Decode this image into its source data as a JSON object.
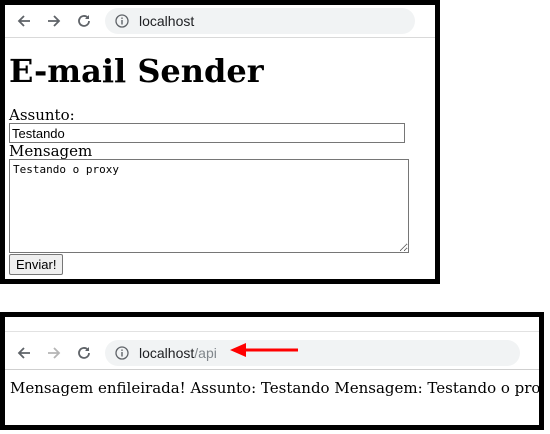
{
  "window1": {
    "address_host": "localhost",
    "heading": "E-mail Sender",
    "form": {
      "subject_label": "Assunto:",
      "subject_value": "Testando",
      "message_label": "Mensagem",
      "message_value": "Testando o proxy",
      "send_label": "Enviar!"
    }
  },
  "window2": {
    "address_host": "localhost",
    "address_path": "/api",
    "result_text": "Mensagem enfileirada! Assunto: Testando Mensagem: Testando o proxy"
  },
  "colors": {
    "annotation_arrow": "#ff0000"
  },
  "icons": [
    "back-arrow-icon",
    "forward-arrow-icon",
    "reload-icon",
    "info-icon",
    "red-arrow-icon"
  ]
}
